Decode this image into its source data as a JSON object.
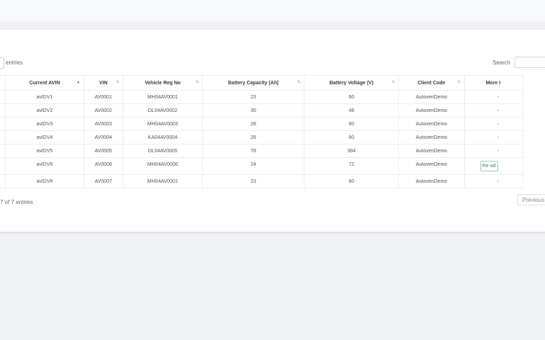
{
  "controls": {
    "entries_label": "entries",
    "search_label": "Search",
    "search_value": ""
  },
  "table": {
    "headers": [
      "Current AVIN",
      "VIN",
      "Vehicle Reg No",
      "Battery Capacity (Ah)",
      "Battery Voltage (V)",
      "Client Code",
      "More I"
    ],
    "rows": [
      {
        "avin": "avIDV1",
        "vin": "AV0001",
        "reg": "MH04AV0001",
        "cap": "23",
        "volt": "60",
        "client": "AutovenDemo",
        "more": "-"
      },
      {
        "avin": "avIDV2",
        "vin": "AV0002",
        "reg": "DL04AV0002",
        "cap": "30",
        "volt": "48",
        "client": "AutovenDemo",
        "more": "-"
      },
      {
        "avin": "avIDV3",
        "vin": "AV0003",
        "reg": "MH04AV0003",
        "cap": "28",
        "volt": "60",
        "client": "AutovenDemo",
        "more": "-"
      },
      {
        "avin": "avIDV4",
        "vin": "AV0004",
        "reg": "KA04AV0004",
        "cap": "28",
        "volt": "60",
        "client": "AutovenDemo",
        "more": "-"
      },
      {
        "avin": "avIDV5",
        "vin": "AV0005",
        "reg": "DL04AV0005",
        "cap": "78",
        "volt": "384",
        "client": "AutovenDemo",
        "more": "-"
      },
      {
        "avin": "avIDV6",
        "vin": "AV0006",
        "reg": "MH04AV0006",
        "cap": "24",
        "volt": "72",
        "client": "AutovenDemo",
        "more": "",
        "button": "Re-ad"
      },
      {
        "avin": "avIDV8",
        "vin": "AV0007",
        "reg": "MH04AV0001",
        "cap": "23",
        "volt": "60",
        "client": "AutovenDemo",
        "more": "-"
      }
    ]
  },
  "footer": {
    "info": "7 of 7 entries",
    "previous": "Previous"
  },
  "colors": {
    "page_bg": "#f0f1f4",
    "card_bg": "#ffffff",
    "button_accent": "#3b8a6e"
  }
}
